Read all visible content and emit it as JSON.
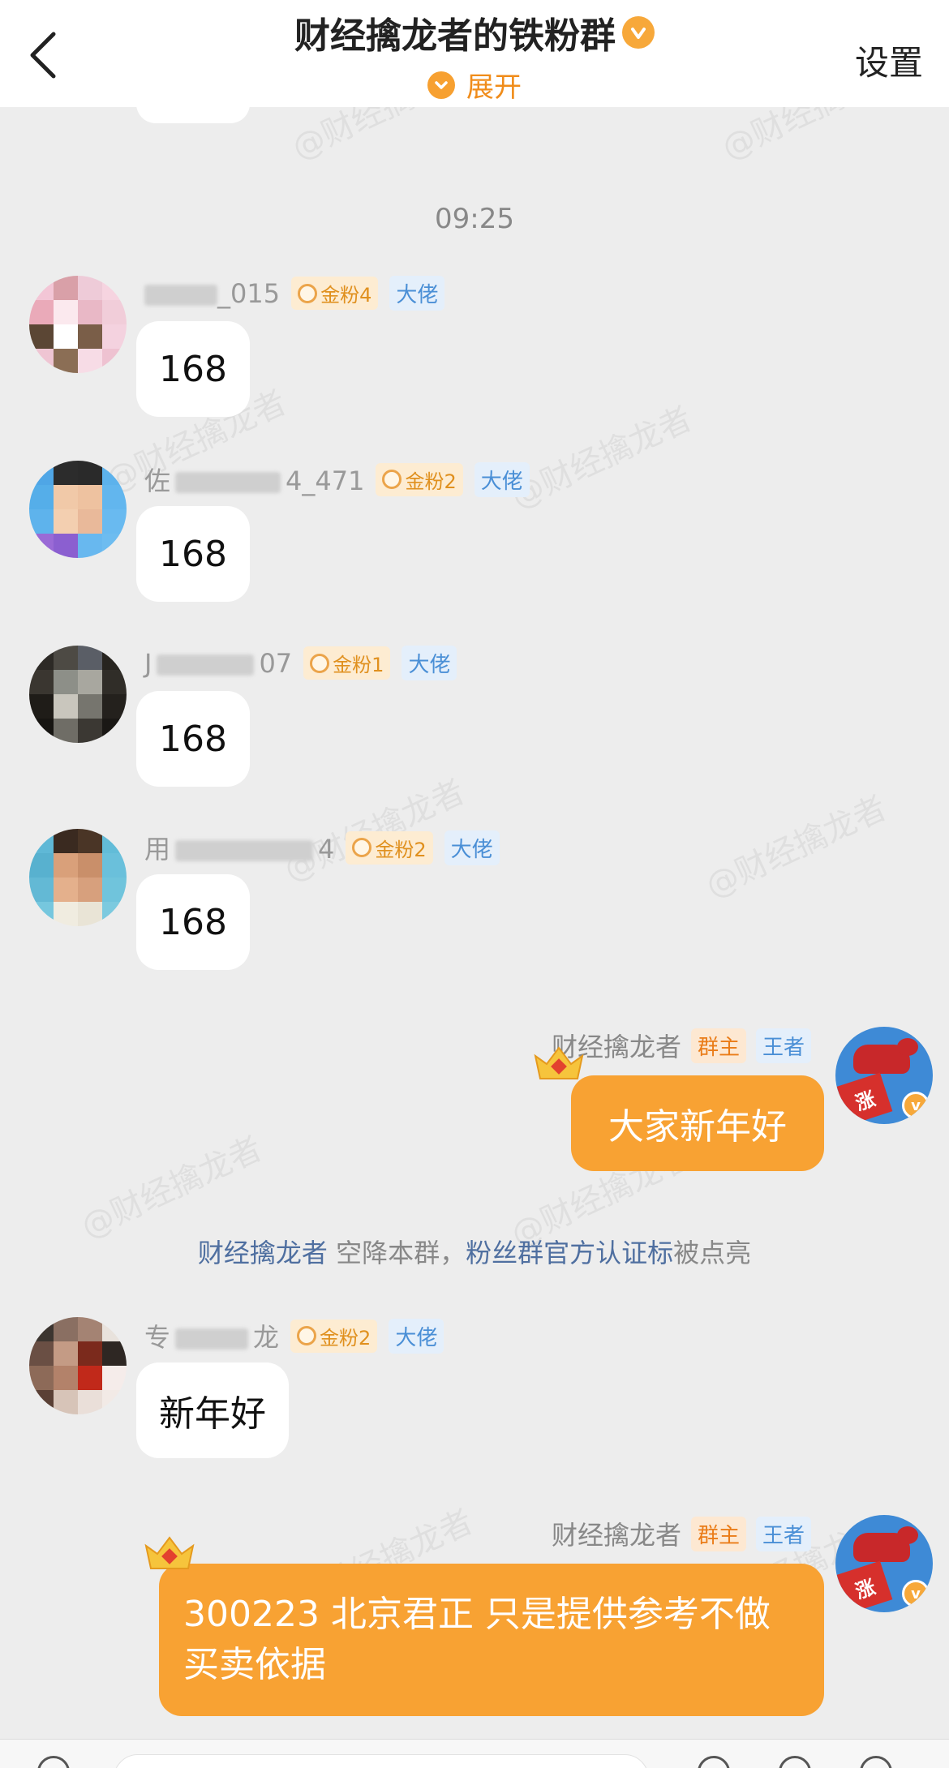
{
  "header": {
    "back_label": "返回",
    "title": "财经擒龙者的铁粉群",
    "expand_label": "展开",
    "settings_label": "设置"
  },
  "watermark_text": "@财经擒龙者",
  "timestamp": "09:25",
  "messages": [
    {
      "name_visible": "_015",
      "fan_level": "金粉4",
      "tag": "大佬",
      "text": "168"
    },
    {
      "name_visible_start": "佐",
      "name_visible_end": "4_471",
      "fan_level": "金粉2",
      "tag": "大佬",
      "text": "168"
    },
    {
      "name_visible_start": "J",
      "name_visible_end": "07",
      "fan_level": "金粉1",
      "tag": "大佬",
      "text": "168"
    },
    {
      "name_visible_start": "用",
      "name_visible_end": "4",
      "fan_level": "金粉2",
      "tag": "大佬",
      "text": "168"
    },
    {
      "name_visible_start": "专",
      "name_visible_end": "龙",
      "fan_level": "金粉2",
      "tag": "大佬",
      "text": "新年好"
    }
  ],
  "owner": {
    "name": "财经擒龙者",
    "role_tag": "群主",
    "level_tag": "王者",
    "avatar_char": "涨",
    "verified_char": "v",
    "msg1": "大家新年好",
    "msg2": "300223 北京君正  只是提供参考不做买卖依据"
  },
  "system_notice": {
    "part1": "财经擒龙者",
    "part2": " 空降本群，",
    "part3": "粉丝群官方认证标",
    "part4": "被点亮"
  },
  "colors": {
    "accent_orange": "#f8a233",
    "link_blue": "#4f6fa0",
    "tag_blue": "#4a8fd6",
    "background": "#ededed"
  }
}
